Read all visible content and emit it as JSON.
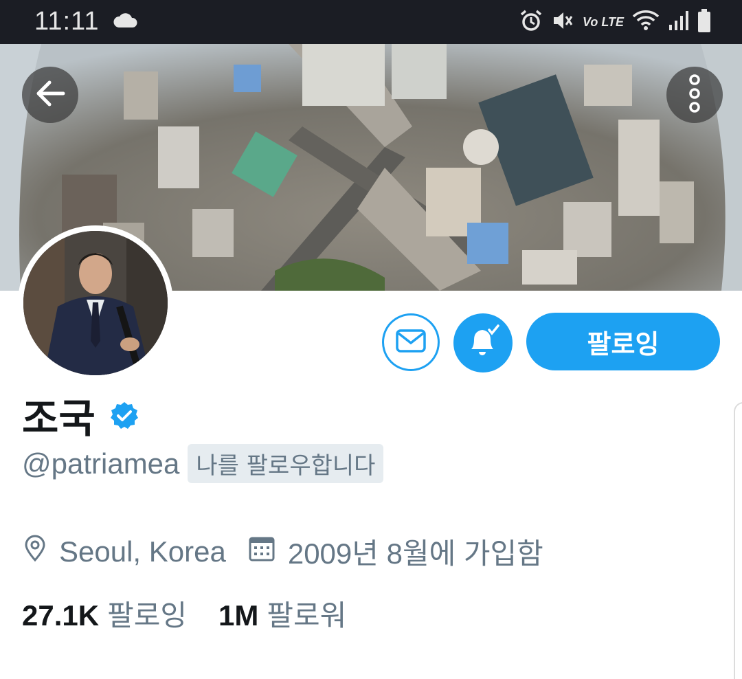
{
  "status_bar": {
    "time": "11:11",
    "network_label": "Vo LTE",
    "icons": [
      "cloud-icon",
      "alarm-icon",
      "mute-icon",
      "wifi-icon",
      "signal-icon",
      "battery-icon"
    ]
  },
  "header": {
    "back_icon": "arrow-left-icon",
    "more_icon": "more-vertical-icon"
  },
  "profile": {
    "name": "조국",
    "verified": true,
    "handle": "@patriamea",
    "follows_you_badge": "나를 팔로우합니다",
    "location": "Seoul, Korea",
    "joined": "2009년 8월에 가입함",
    "following_count": "27.1K",
    "following_label": "팔로잉",
    "followers_count": "1M",
    "followers_label": "팔로워"
  },
  "actions": {
    "message_icon": "envelope-icon",
    "notifications_icon": "bell-check-icon",
    "follow_button_label": "팔로잉"
  },
  "colors": {
    "accent": "#1da1f2",
    "secondary_text": "#657786",
    "primary_text": "#14171a",
    "badge_bg": "#e6ecf0",
    "status_bar_bg": "#1b1d24"
  }
}
